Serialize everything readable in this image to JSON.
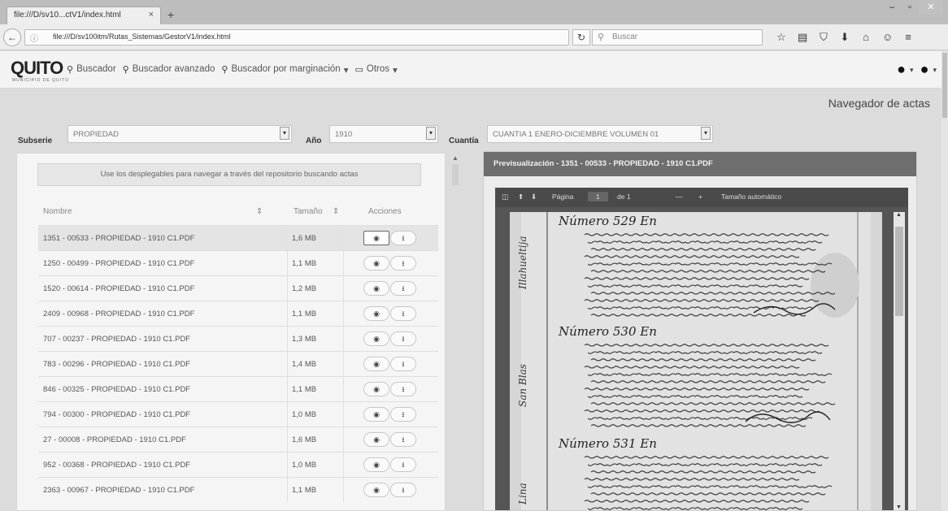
{
  "browser": {
    "tab_title": "file:///D/sv10...ctV1/index.html",
    "tab_close": "×",
    "new_tab": "+",
    "url": "file:///D/sv100itm/Rutas_Sistemas/GestorV1/index.html",
    "search_placeholder": "Buscar",
    "window_controls": [
      "–",
      "▫",
      "✕"
    ]
  },
  "app": {
    "logo": "QUITO",
    "logo_sub": "MUNICIPIO DE QUITO",
    "menu": [
      {
        "icon": "search-icon",
        "glyph": "⚲",
        "label": "Buscador"
      },
      {
        "icon": "search-icon",
        "glyph": "⚲",
        "label": "Buscador avanzado"
      },
      {
        "icon": "search-icon",
        "glyph": "⚲",
        "label": "Buscador por marginación"
      },
      {
        "icon": "folder-icon",
        "glyph": "▭",
        "label": "Otros"
      }
    ],
    "page_title": "Navegador de actas"
  },
  "filters": {
    "subserie_label": "Subserie",
    "subserie_value": "PROPIEDAD",
    "anio_label": "Año",
    "anio_value": "1910",
    "cuantia_label": "Cuantía",
    "cuantia_value": "CUANTIA 1 ENERO-DICIEMBRE VOLUMEN 01"
  },
  "list": {
    "hint": "Use los desplegables para navegar a través del repositorio buscando actas",
    "columns": {
      "name": "Nombre",
      "size": "Tamaño",
      "actions": "Acciones"
    },
    "sort_glyph": "⇕",
    "rows": [
      {
        "name": "1351 - 00533 - PROPIEDAD - 1910 C1.PDF",
        "size": "1,6 MB",
        "selected": true
      },
      {
        "name": "1250 - 00499 - PROPIEDAD - 1910 C1.PDF",
        "size": "1,1 MB",
        "selected": false
      },
      {
        "name": "1520 - 00614 - PROPIEDAD - 1910 C1.PDF",
        "size": "1,2 MB",
        "selected": false
      },
      {
        "name": "2409 - 00968 - PROPIEDAD - 1910 C1.PDF",
        "size": "1,1 MB",
        "selected": false
      },
      {
        "name": "707 - 00237 - PROPIEDAD - 1910 C1.PDF",
        "size": "1,3 MB",
        "selected": false
      },
      {
        "name": "783 - 00296 - PROPIEDAD - 1910 C1.PDF",
        "size": "1,4 MB",
        "selected": false
      },
      {
        "name": "846 - 00325 - PROPIEDAD - 1910 C1.PDF",
        "size": "1,1 MB",
        "selected": false
      },
      {
        "name": "794 - 00300 - PROPIEDAD - 1910 C1.PDF",
        "size": "1,0 MB",
        "selected": false
      },
      {
        "name": "27 - 00008 - PROPIEDAD - 1910 C1.PDF",
        "size": "1,6 MB",
        "selected": false
      },
      {
        "name": "952 - 00368 - PROPIEDAD - 1910 C1.PDF",
        "size": "1,0 MB",
        "selected": false
      },
      {
        "name": "2363 - 00967 - PROPIEDAD - 1910 C1.PDF",
        "size": "1,1 MB",
        "selected": false
      }
    ]
  },
  "preview": {
    "title": "Previsualización - 1351 - 00533 - PROPIEDAD - 1910 C1.PDF",
    "pdf_toolbar": {
      "page_label": "Página",
      "page_value": "1",
      "page_of": "de 1",
      "zoom_out": "—",
      "zoom_in": "+",
      "zoom_mode": "Tamaño automático"
    },
    "scan_headings": [
      "Número 529 En",
      "Número 530 En",
      "Número 531 En"
    ]
  }
}
